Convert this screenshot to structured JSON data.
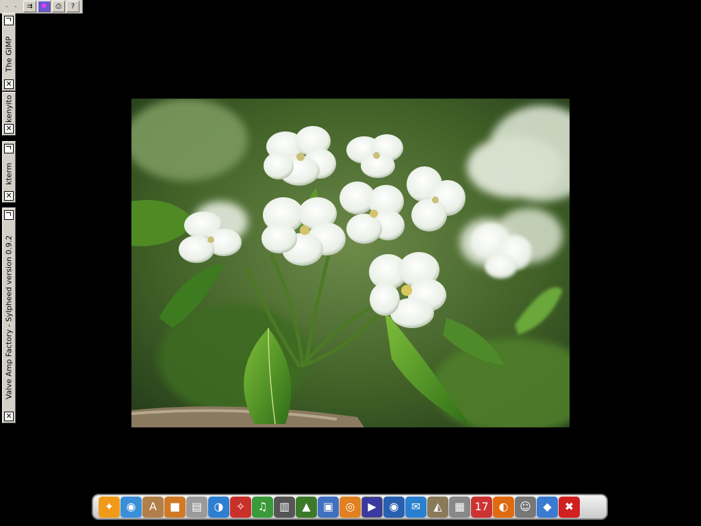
{
  "top_bar": {
    "desk_label": "- - - -",
    "buttons": [
      {
        "icon": "tray-toggle-icon",
        "glyph": "⇉"
      },
      {
        "icon": "butterfly-icon",
        "glyph": "✺"
      },
      {
        "icon": "printer-icon",
        "glyph": "⎙"
      },
      {
        "icon": "help-icon",
        "glyph": "?"
      }
    ]
  },
  "window_tabs": [
    {
      "title": "The GIMP"
    },
    {
      "title": "kenyito"
    },
    {
      "title": "kterm"
    },
    {
      "title": "Valve Amp Factory - Sylpheed version 0.9.2"
    }
  ],
  "close_glyph": "✕",
  "dock": {
    "items": [
      {
        "icon": "shell-icon",
        "glyph": "✦",
        "color": "#f09a1a"
      },
      {
        "icon": "network-globe-icon",
        "glyph": "◉",
        "color": "#3b8fd9"
      },
      {
        "icon": "text-editor-icon",
        "glyph": "A",
        "color": "#b07f4a"
      },
      {
        "icon": "package-icon",
        "glyph": "■",
        "color": "#d07a25"
      },
      {
        "icon": "document-icon",
        "glyph": "▤",
        "color": "#9a9a9a"
      },
      {
        "icon": "headphones-icon",
        "glyph": "◑",
        "color": "#2f7fd0"
      },
      {
        "icon": "pdf-reader-icon",
        "glyph": "✧",
        "color": "#c8312a"
      },
      {
        "icon": "music-cd-icon",
        "glyph": "♫",
        "color": "#3a9a3a"
      },
      {
        "icon": "film-icon",
        "glyph": "▥",
        "color": "#555555"
      },
      {
        "icon": "image-viewer-icon",
        "glyph": "▲",
        "color": "#3c7a2a"
      },
      {
        "icon": "network-computer-icon",
        "glyph": "▣",
        "color": "#4070c0"
      },
      {
        "icon": "blender-icon",
        "glyph": "◎",
        "color": "#e08020"
      },
      {
        "icon": "media-player-icon",
        "glyph": "▶",
        "color": "#3a3aa0"
      },
      {
        "icon": "eye-icon",
        "glyph": "◉",
        "color": "#2a5fb0"
      },
      {
        "icon": "mail-icon",
        "glyph": "✉",
        "color": "#2a80d0"
      },
      {
        "icon": "gimp-icon",
        "glyph": "◭",
        "color": "#8a7a5a"
      },
      {
        "icon": "calculator-icon",
        "glyph": "▦",
        "color": "#888888"
      },
      {
        "icon": "calendar-icon",
        "glyph": "17",
        "color": "#cc3333"
      },
      {
        "icon": "firefox-icon",
        "glyph": "◐",
        "color": "#e06a10"
      },
      {
        "icon": "users-icon",
        "glyph": "☺",
        "color": "#777777"
      },
      {
        "icon": "cube-icon",
        "glyph": "◆",
        "color": "#3a7ad0"
      },
      {
        "icon": "close-red-icon",
        "glyph": "✖",
        "color": "#d02020"
      }
    ]
  }
}
